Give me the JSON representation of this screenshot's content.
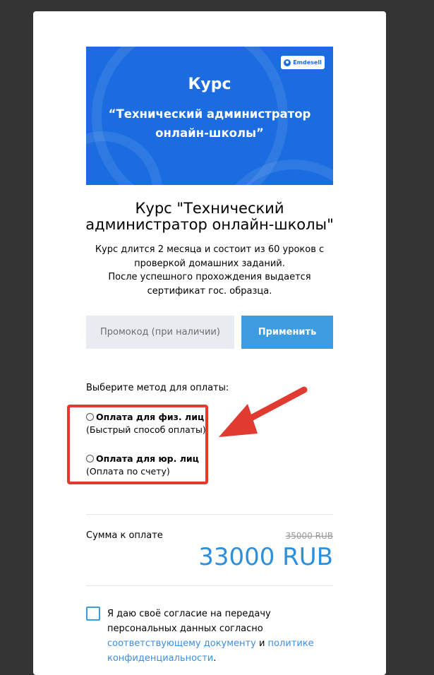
{
  "banner": {
    "brand": "Emdesell",
    "title": "Курс",
    "subtitle_line1": "“Технический администратор",
    "subtitle_line2": "онлайн-школы”",
    "color": "#1a6ce0"
  },
  "course": {
    "title": "Курс \"Технический администратор онлайн-школы\"",
    "desc_line1": "Курс длится 2 месяца и состоит из 60 уроков с",
    "desc_line2": "проверкой домашних заданий.",
    "desc_line3": "После успешного прохождения выдается",
    "desc_line4": "сертификат гос. образца."
  },
  "promo": {
    "placeholder": "Промокод (при наличии)",
    "apply_label": "Применить",
    "apply_color": "#3d9be0"
  },
  "payment": {
    "label": "Выберите метод для оплаты:",
    "options": [
      {
        "label": "Оплата для физ. лиц",
        "note": "(Быстрый способ оплаты)"
      },
      {
        "label": "Оплата для юр. лиц",
        "note": "(Оплата по счету)"
      }
    ],
    "highlight_color": "#e03a31"
  },
  "summary": {
    "label": "Сумма к оплате",
    "old_price": "35000 RUB",
    "new_price": "33000 RUB",
    "price_color": "#2e8fda"
  },
  "consent": {
    "text_1": "Я даю своё согласие на передачу персональных данных согласно ",
    "link_1": "соответствующему документу",
    "text_2": " и ",
    "link_2": "политике конфиденциальности",
    "text_3": "."
  }
}
